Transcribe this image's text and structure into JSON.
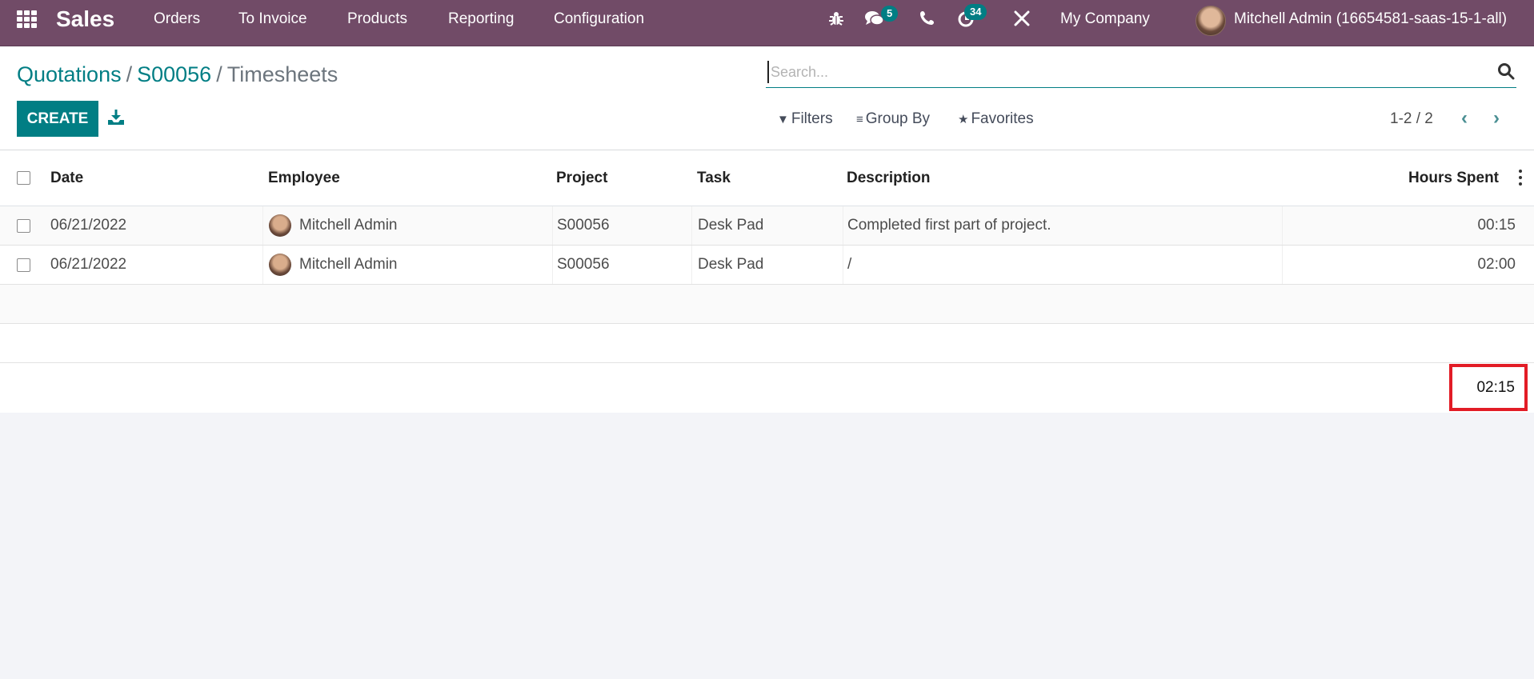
{
  "navbar": {
    "app_name": "Sales",
    "menu": [
      "Orders",
      "To Invoice",
      "Products",
      "Reporting",
      "Configuration"
    ],
    "icons": {
      "apps": "apps-grid-icon",
      "debug": "bug-icon",
      "messages": "chat-icon",
      "phone": "phone-icon",
      "activities": "clock-icon",
      "tools": "tools-icon"
    },
    "messages_badge": "5",
    "activities_badge": "34",
    "company": "My Company",
    "user": "Mitchell Admin (16654581-saas-15-1-all)"
  },
  "breadcrumb": {
    "items": [
      "Quotations",
      "S00056"
    ],
    "separator": "/",
    "current": "Timesheets"
  },
  "toolbar": {
    "create_label": "CREATE",
    "download_icon": "download-icon"
  },
  "search": {
    "placeholder": "Search...",
    "value": ""
  },
  "filters": {
    "filters_label": "Filters",
    "groupby_label": "Group By",
    "favorites_label": "Favorites"
  },
  "pager": {
    "value": "1-2 / 2",
    "prev_icon": "chevron-left-icon",
    "next_icon": "chevron-right-icon"
  },
  "table": {
    "columns": [
      "Date",
      "Employee",
      "Project",
      "Task",
      "Description",
      "Hours Spent"
    ],
    "rows": [
      {
        "date": "06/21/2022",
        "employee": "Mitchell Admin",
        "project": "S00056",
        "task": "Desk Pad",
        "description": "Completed first part of project.",
        "hours": "00:15"
      },
      {
        "date": "06/21/2022",
        "employee": "Mitchell Admin",
        "project": "S00056",
        "task": "Desk Pad",
        "description": "/",
        "hours": "02:00"
      }
    ],
    "total_hours": "02:15"
  },
  "colors": {
    "navbar": "#714b67",
    "accent": "#017e84",
    "highlight": "#e21c26"
  }
}
